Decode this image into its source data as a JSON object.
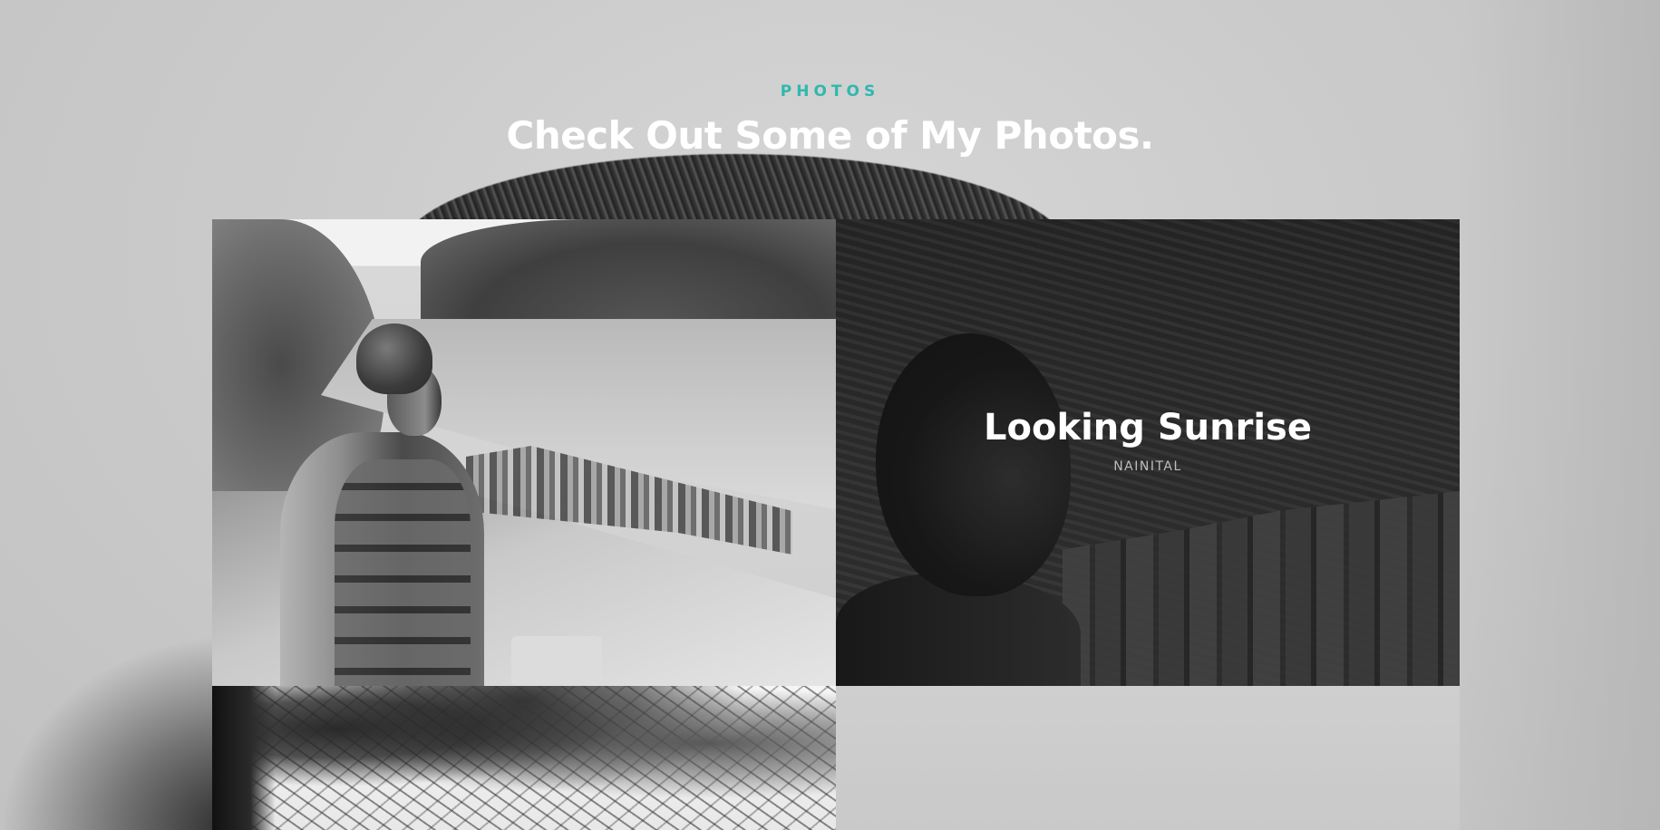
{
  "section": {
    "eyebrow": "PHOTOS",
    "headline": "Check Out Some of My Photos."
  },
  "colors": {
    "accent": "#30b8ae",
    "headline": "#ffffff",
    "caption_title": "#ffffff",
    "caption_subtitle": "#bdbdbd"
  },
  "gallery": {
    "tiles": [
      {
        "name": "rafting-photo",
        "title": "",
        "subtitle": ""
      },
      {
        "name": "looking-sunrise-photo",
        "title": "Looking Sunrise",
        "subtitle": "NAINITAL",
        "state": "hover"
      },
      {
        "name": "trees-photo",
        "title": "",
        "subtitle": ""
      },
      {
        "name": "empty-photo",
        "title": "",
        "subtitle": ""
      }
    ]
  }
}
